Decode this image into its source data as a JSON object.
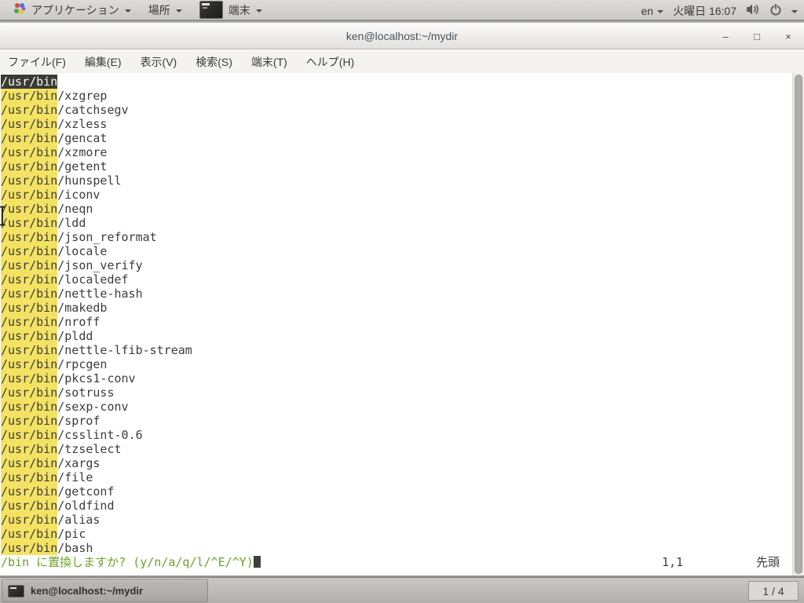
{
  "colors": {
    "search_highlight_bg": "#f4e263",
    "current_match_bg": "#3b3b36",
    "current_match_fg": "#f7f7f5",
    "terminal_fg": "#3c3c3c",
    "prompt_fg": "#6da226",
    "panel_bg": "#d4d2ce"
  },
  "panel": {
    "applications_label": "アプリケーション",
    "places_label": "場所",
    "active_app_label": "端末",
    "language": "en",
    "clock": "火曜日 16:07"
  },
  "window": {
    "title": "ken@localhost:~/mydir",
    "minimize_glyph": "–",
    "maximize_glyph": "□",
    "close_glyph": "×"
  },
  "menubar": {
    "items": [
      "ファイル(F)",
      "編集(E)",
      "表示(V)",
      "検索(S)",
      "端末(T)",
      "ヘルプ(H)"
    ]
  },
  "terminal": {
    "match_text": "/usr/bin",
    "entries": [
      "",
      "/xzgrep",
      "/catchsegv",
      "/xzless",
      "/gencat",
      "/xzmore",
      "/getent",
      "/hunspell",
      "/iconv",
      "/neqn",
      "/ldd",
      "/json_reformat",
      "/locale",
      "/json_verify",
      "/localedef",
      "/nettle-hash",
      "/makedb",
      "/nroff",
      "/pldd",
      "/nettle-lfib-stream",
      "/rpcgen",
      "/pkcs1-conv",
      "/sotruss",
      "/sexp-conv",
      "/sprof",
      "/csslint-0.6",
      "/tzselect",
      "/xargs",
      "/file",
      "/getconf",
      "/oldfind",
      "/alias",
      "/pic",
      "/bash"
    ],
    "prompt": "/bin に置換しますか? (y/n/a/q/l/^E/^Y)",
    "ruler": "1,1",
    "scroll_position": "先頭"
  },
  "taskbar": {
    "task_label": "ken@localhost:~/mydir",
    "pager": "1 / 4"
  }
}
